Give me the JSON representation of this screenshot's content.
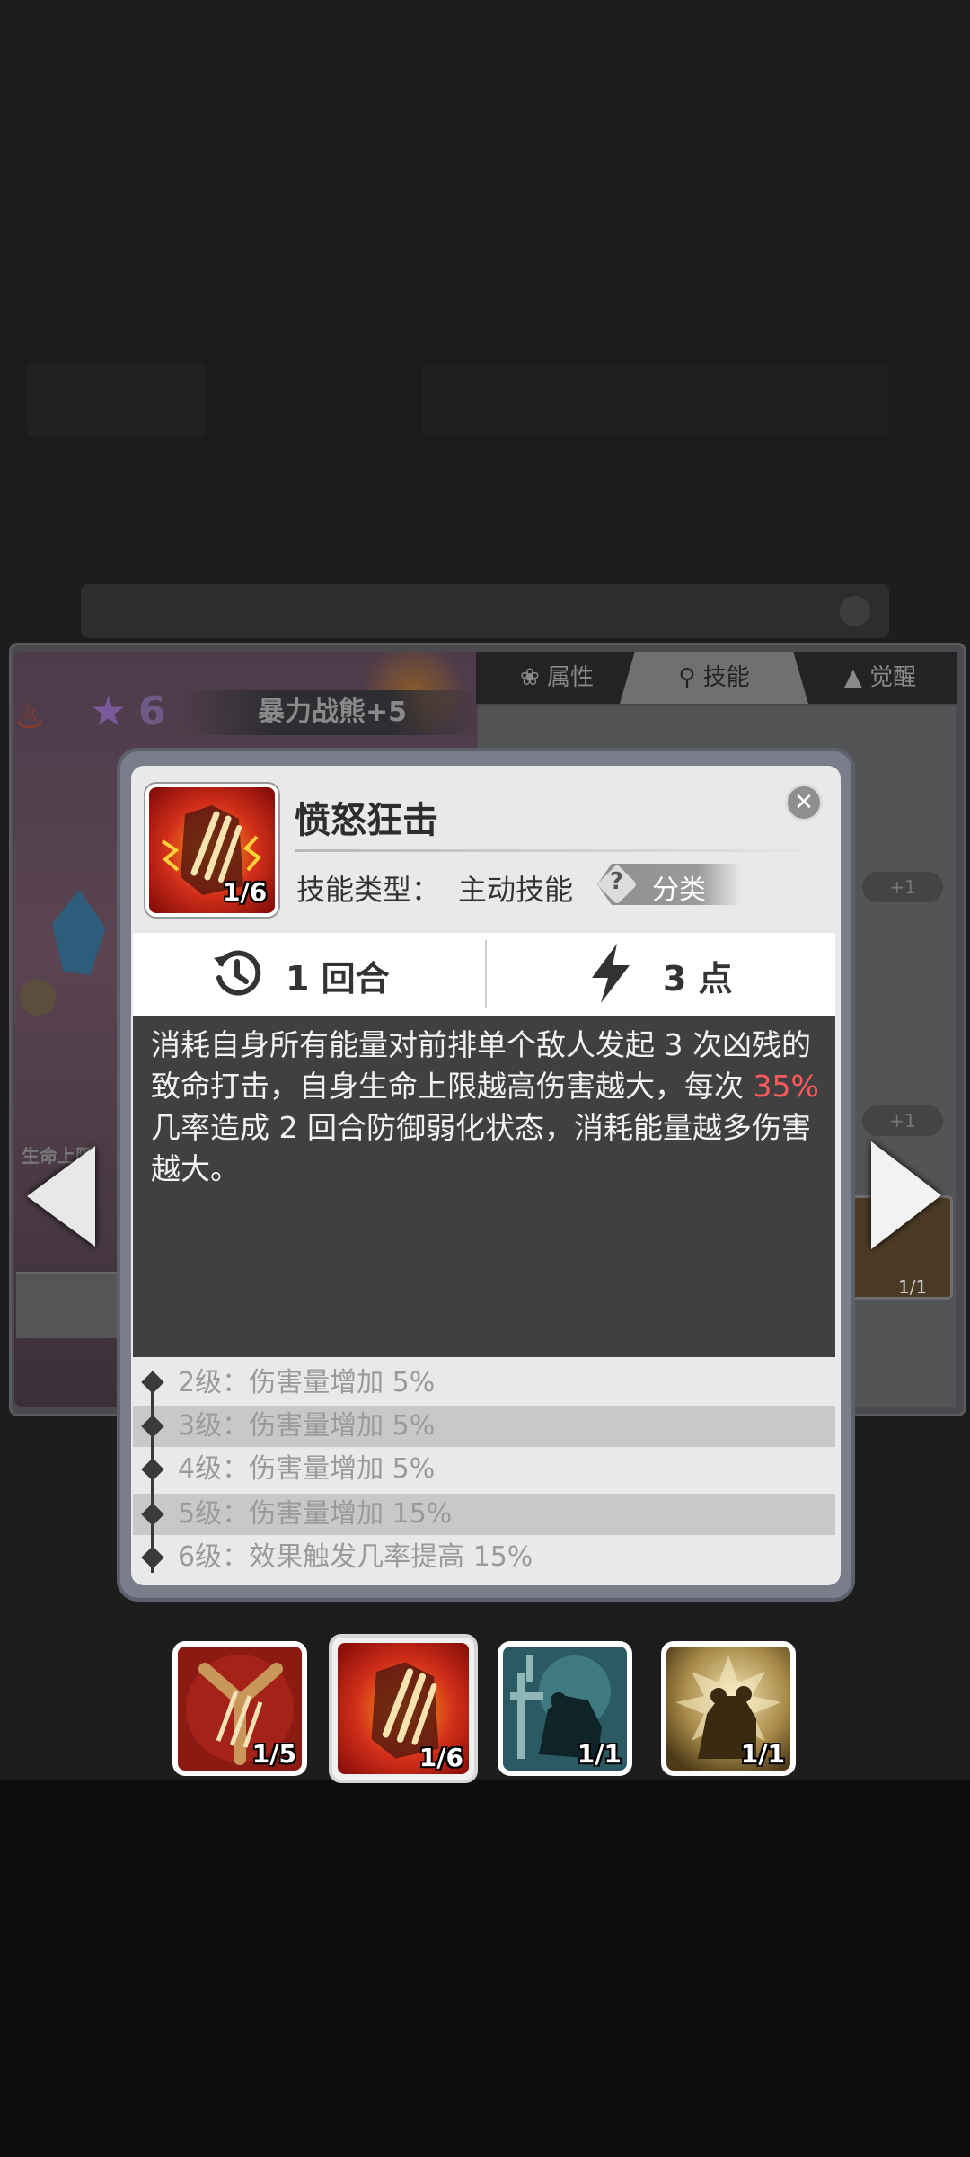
{
  "hero": {
    "stars": "6",
    "name": "暴力战熊+5",
    "life_label": "生命上限"
  },
  "tabs": [
    {
      "label": "属性",
      "icon": "attributes-icon"
    },
    {
      "label": "技能",
      "icon": "skill-icon"
    },
    {
      "label": "觉醒",
      "icon": "awaken-icon"
    }
  ],
  "side_pills": [
    "+1",
    "+1"
  ],
  "side_thumb_level": "1/1",
  "skill": {
    "title": "愤怒狂击",
    "level": "1/6",
    "type_label": "技能类型：",
    "type_value": "主动技能",
    "category_label": "分类",
    "cooldown": "1 回合",
    "energy_cost": "3 点",
    "description_part1": "消耗自身所有能量对前排单个敌人发起 3 次凶残的致命打击，自身生命上限越高伤害越大，每次 ",
    "description_highlight": "35%",
    "description_part2": " 几率造成 2 回合防御弱化状态，消耗能量越多伤害越大。",
    "highlight_color": "#ff5a5a",
    "upgrades": [
      "2级：伤害量增加 5%",
      "3级：伤害量增加 5%",
      "4级：伤害量增加 5%",
      "5级：伤害量增加 15%",
      "6级：效果触发几率提高 15%"
    ]
  },
  "skill_bar": [
    {
      "level": "1/5",
      "icon": "claw-slash-icon",
      "selected": false
    },
    {
      "level": "1/6",
      "icon": "rage-claw-icon",
      "selected": true
    },
    {
      "level": "1/1",
      "icon": "bear-shield-icon",
      "selected": false
    },
    {
      "level": "1/1",
      "icon": "bear-roar-icon",
      "selected": false
    }
  ]
}
